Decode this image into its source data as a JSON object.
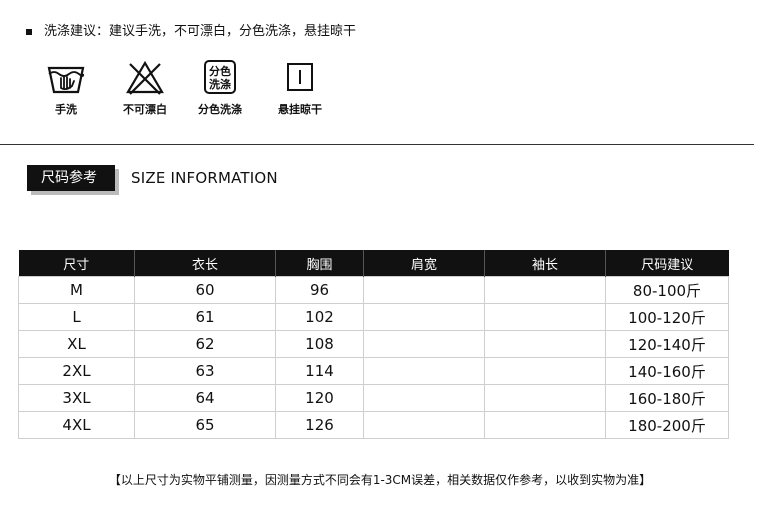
{
  "care": {
    "heading": "洗涤建议：建议手洗，不可漂白，分色洗涤，悬挂晾干",
    "icons": [
      {
        "icon": "hand-wash-icon",
        "label": "手洗"
      },
      {
        "icon": "no-bleach-icon",
        "label": "不可漂白"
      },
      {
        "icon": "separate-wash-icon",
        "label": "分色洗涤",
        "badge_line1": "分色",
        "badge_line2": "洗涤"
      },
      {
        "icon": "hang-dry-icon",
        "label": "悬挂晾干"
      }
    ]
  },
  "size_section": {
    "badge": "尺码参考",
    "title": "SIZE INFORMATION"
  },
  "size_table": {
    "headers": [
      "尺寸",
      "衣长",
      "胸围",
      "肩宽",
      "袖长",
      "尺码建议"
    ],
    "rows": [
      [
        "M",
        "60",
        "96",
        "",
        "",
        "80-100斤"
      ],
      [
        "L",
        "61",
        "102",
        "",
        "",
        "100-120斤"
      ],
      [
        "XL",
        "62",
        "108",
        "",
        "",
        "120-140斤"
      ],
      [
        "2XL",
        "63",
        "114",
        "",
        "",
        "140-160斤"
      ],
      [
        "3XL",
        "64",
        "120",
        "",
        "",
        "160-180斤"
      ],
      [
        "4XL",
        "65",
        "126",
        "",
        "",
        "180-200斤"
      ]
    ]
  },
  "footer_note": "【以上尺寸为实物平铺测量，因测量方式不同会有1-3CM误差，相关数据仅作参考，以收到实物为准】"
}
